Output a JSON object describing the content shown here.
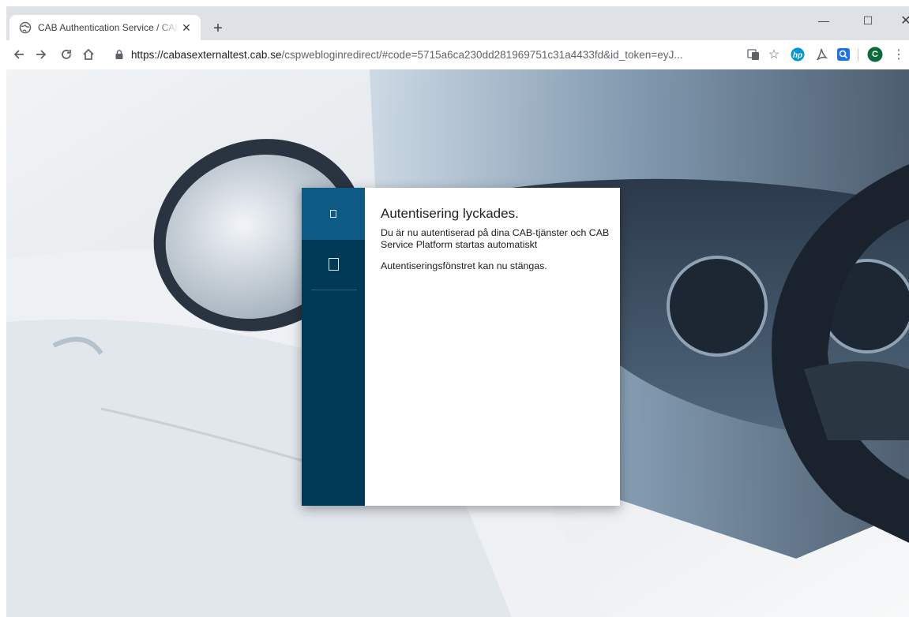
{
  "browser": {
    "tab_title": "CAB Authentication Service / CAB Service Platform",
    "new_tab_label": "+",
    "window_controls": {
      "minimize": "—",
      "maximize": "☐",
      "close": "✕"
    },
    "url_host": "https://cabasexternaltest.cab.se",
    "url_path": "/cspwebloginredirect/#code=5715a6ca230dd281969751c31a4433fd&id_token=eyJ...",
    "avatar_letter": "C"
  },
  "dialog": {
    "title": "Autentisering lyckades.",
    "message": "Du är nu autentiserad på dina CAB-tjänster och CAB Service Platform startas automatiskt",
    "close_hint": "Autentiseringsfönstret kan nu stängas."
  },
  "colors": {
    "sidebar": "#013a56",
    "sidebar_active": "#0d5a84"
  }
}
